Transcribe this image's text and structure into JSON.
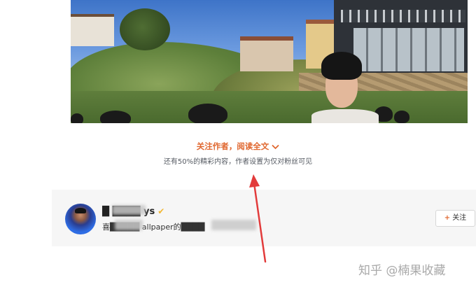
{
  "gate": {
    "follow_prompt": "关注作者，阅读全文",
    "notice": "还有50%的精彩内容，作者设置为仅对粉丝可见"
  },
  "author": {
    "name": "█ ████ ys",
    "bio": "喜█████ allpaper的████",
    "follow_label": "关注",
    "follow_icon": "plus-icon"
  },
  "watermark": {
    "text": "知乎 @楠果收藏"
  },
  "colors": {
    "accent": "#e0672f",
    "annotation": "#e23b3b",
    "verified": "#f2b733"
  }
}
